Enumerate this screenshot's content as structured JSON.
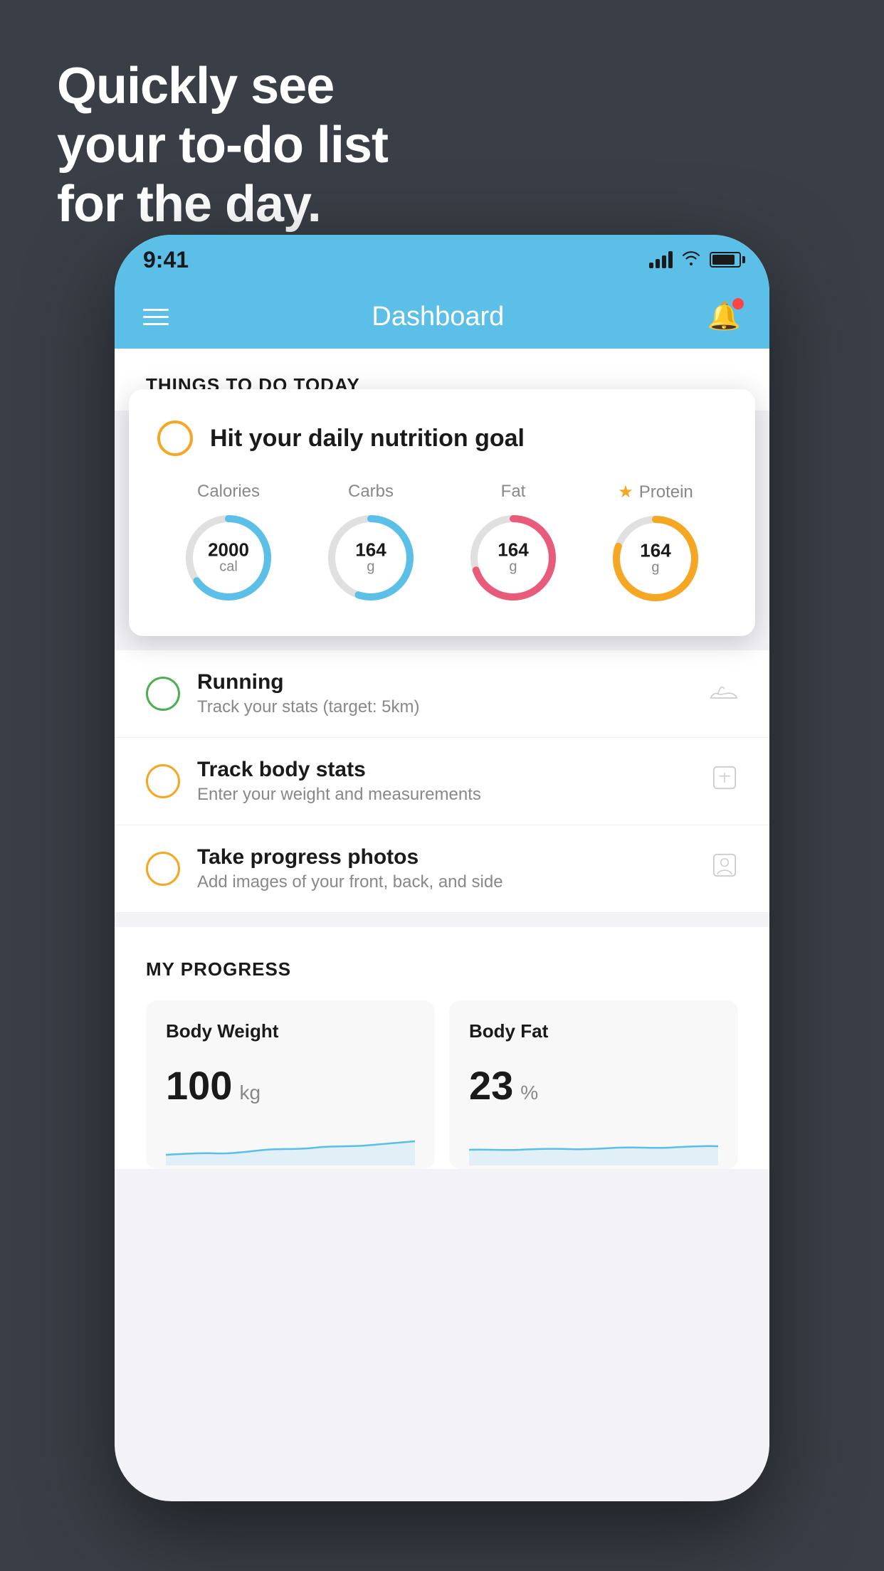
{
  "hero": {
    "line1": "Quickly see",
    "line2": "your to-do list",
    "line3": "for the day."
  },
  "statusBar": {
    "time": "9:41"
  },
  "navbar": {
    "title": "Dashboard"
  },
  "thingsToDo": {
    "sectionTitle": "THINGS TO DO TODAY",
    "nutritionCard": {
      "title": "Hit your daily nutrition goal",
      "items": [
        {
          "label": "Calories",
          "value": "2000",
          "unit": "cal",
          "color": "#5bbfe8",
          "trackColor": "#e0e0e0",
          "pct": 65
        },
        {
          "label": "Carbs",
          "value": "164",
          "unit": "g",
          "color": "#5bbfe8",
          "trackColor": "#e0e0e0",
          "pct": 55
        },
        {
          "label": "Fat",
          "value": "164",
          "unit": "g",
          "color": "#e85b7a",
          "trackColor": "#e0e0e0",
          "pct": 70
        },
        {
          "label": "Protein",
          "value": "164",
          "unit": "g",
          "color": "#f5a623",
          "trackColor": "#e0e0e0",
          "pct": 80,
          "starred": true
        }
      ]
    },
    "todoItems": [
      {
        "id": "running",
        "circleColor": "green",
        "title": "Running",
        "subtitle": "Track your stats (target: 5km)",
        "icon": "shoe"
      },
      {
        "id": "body-stats",
        "circleColor": "yellow",
        "title": "Track body stats",
        "subtitle": "Enter your weight and measurements",
        "icon": "scale"
      },
      {
        "id": "photos",
        "circleColor": "yellow",
        "title": "Take progress photos",
        "subtitle": "Add images of your front, back, and side",
        "icon": "person"
      }
    ]
  },
  "progress": {
    "sectionTitle": "MY PROGRESS",
    "cards": [
      {
        "id": "body-weight",
        "title": "Body Weight",
        "value": "100",
        "unit": "kg"
      },
      {
        "id": "body-fat",
        "title": "Body Fat",
        "value": "23",
        "unit": "%"
      }
    ]
  }
}
